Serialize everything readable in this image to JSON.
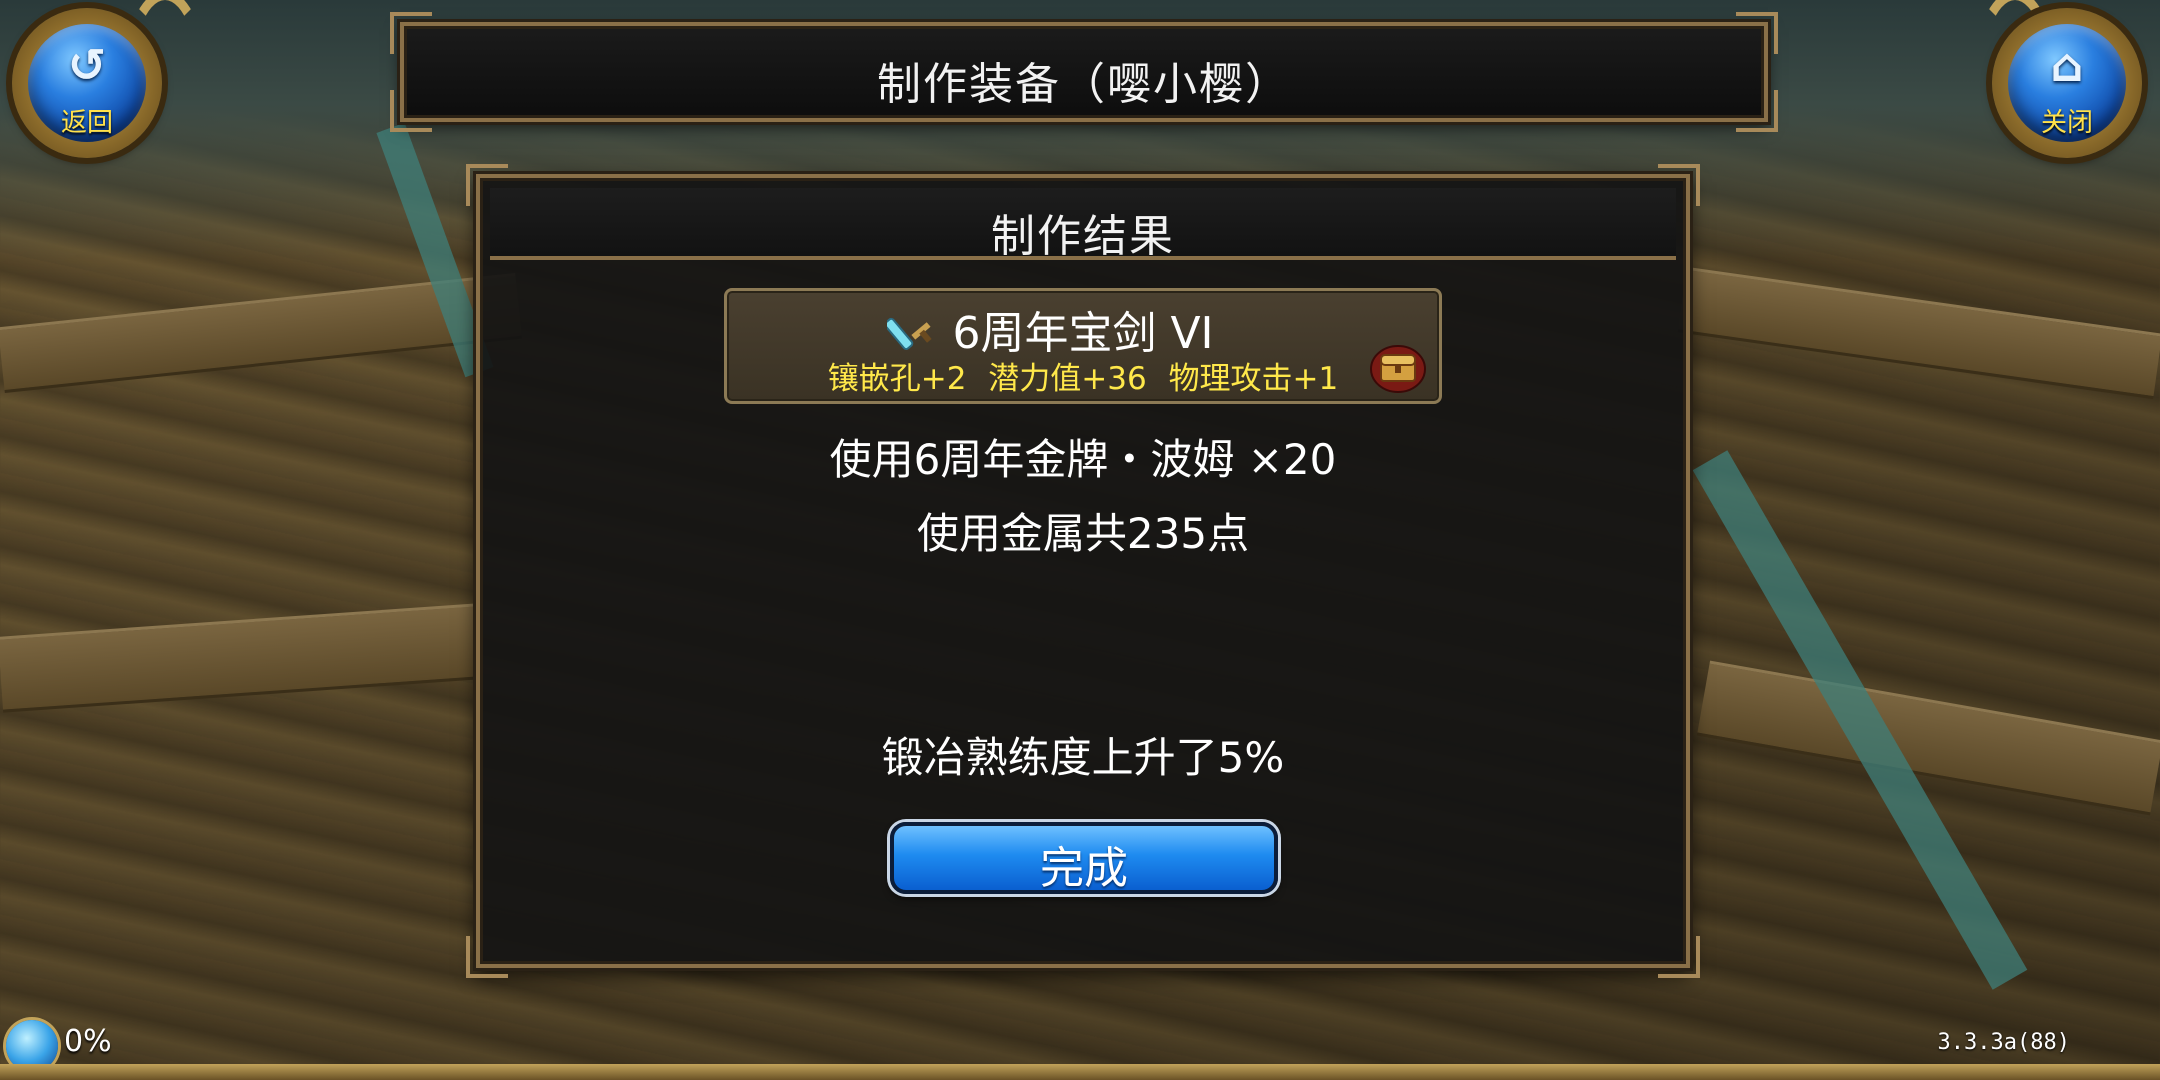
{
  "header": {
    "back_label": "返回",
    "close_label": "关闭",
    "title": "制作装备（嘤小樱）"
  },
  "panel": {
    "title": "制作结果",
    "item": {
      "name": "6周年宝剑 VI",
      "icon": "sword-icon",
      "stats": [
        "镶嵌孔+2",
        "潜力值+36",
        "物理攻击+1"
      ],
      "side_icon": "treasure-chest-icon"
    },
    "use_medal_line": "使用6周年金牌・波姆 ×20",
    "use_metal_line": "使用金属共235点",
    "proficiency_line": "锻冶熟练度上升了5%",
    "done_label": "完成"
  },
  "status": {
    "progress_text": "0%",
    "version": "3.3.3a(88)"
  },
  "colors": {
    "stat_yellow": "#ffe84a",
    "button_blue": "#1e8bf0",
    "frame_gold": "#8a7048"
  }
}
